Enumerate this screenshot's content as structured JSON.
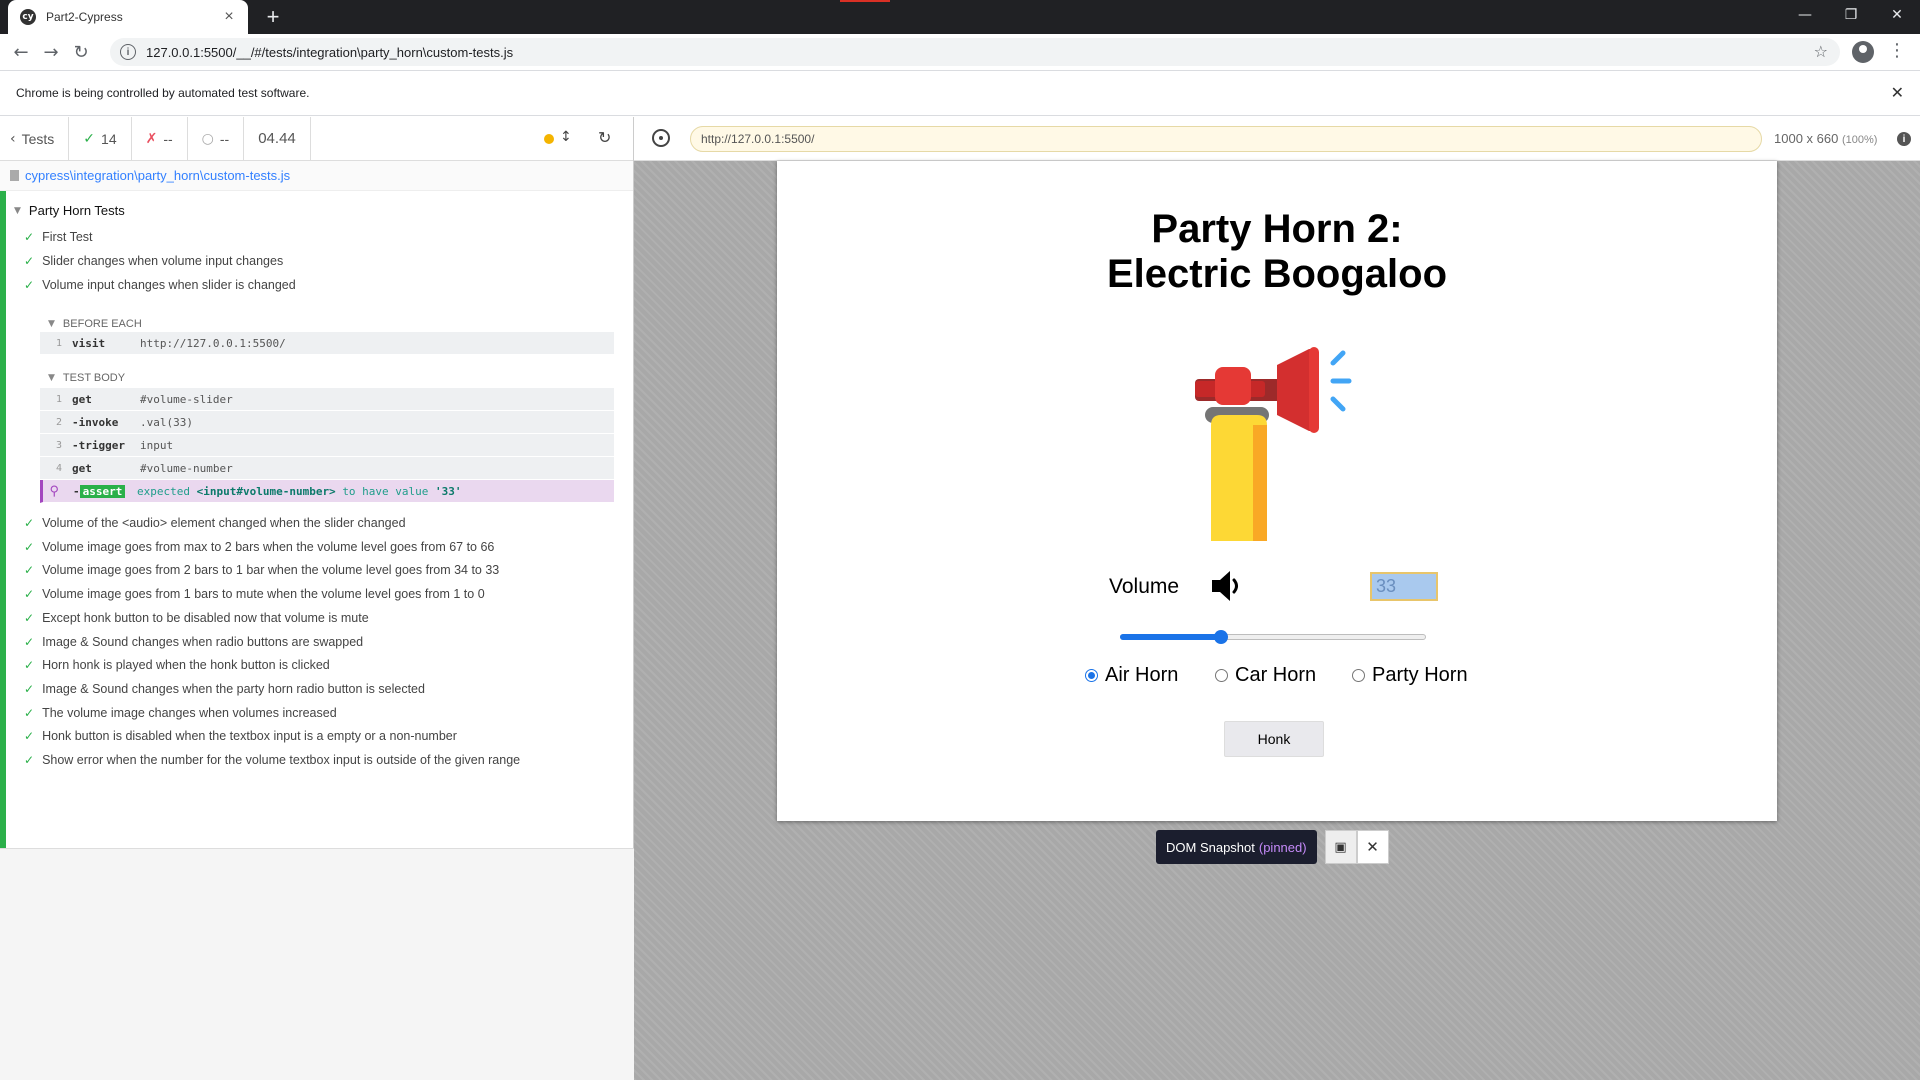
{
  "browser": {
    "tab_title": "Part2-Cypress",
    "tab_favicon": "cy",
    "url": "127.0.0.1:5500/__/#/tests/integration\\party_horn\\custom-tests.js",
    "infobar_text": "Chrome is being controlled by automated test software."
  },
  "reporter": {
    "back_label": "Tests",
    "passed": "14",
    "failed": "--",
    "pending": "--",
    "duration": "04.44",
    "spec_path": "cypress\\integration\\party_horn\\custom-tests.js",
    "suite_title": "Party Horn Tests",
    "tests_before": [
      "First Test",
      "Slider changes when volume input changes",
      "Volume input changes when slider is changed"
    ],
    "before_each_label": "BEFORE EACH",
    "before_each_cmds": [
      {
        "num": "1",
        "name": "visit",
        "msg": "http://127.0.0.1:5500/"
      }
    ],
    "test_body_label": "TEST BODY",
    "test_body_cmds": [
      {
        "num": "1",
        "name": "get",
        "msg": "#volume-slider"
      },
      {
        "num": "2",
        "name": "-invoke",
        "msg": ".val(33)"
      },
      {
        "num": "3",
        "name": "-trigger",
        "msg": "input"
      },
      {
        "num": "4",
        "name": "get",
        "msg": "#volume-number"
      }
    ],
    "assert_cmd": {
      "name": "assert",
      "msg_prefix": "expected",
      "msg_subject": "<input#volume-number>",
      "msg_mid": "to have value",
      "msg_value": "'33'"
    },
    "tests_after": [
      "Volume of the <audio> element changed when the slider changed",
      "Volume image goes from max to 2 bars when the volume level goes from 67 to 66",
      "Volume image goes from 2 bars to 1 bar when the volume level goes from 34 to 33",
      "Volume image goes from 1 bars to mute when the volume level goes from 1 to 0",
      "Except honk button to be disabled now that volume is mute",
      "Image & Sound changes when radio buttons are swapped",
      "Horn honk is played when the honk button is clicked",
      "Image & Sound changes when the party horn radio button is selected",
      "The volume image changes when volumes increased",
      "Honk button is disabled when the textbox input is a empty or a non-number",
      "Show error when the number for the volume textbox input is outside of the given range"
    ]
  },
  "aut": {
    "url": "http://127.0.0.1:5500/",
    "viewport": "1000 x 660",
    "viewport_pct": "(100%)"
  },
  "app": {
    "title_line1": "Party Horn 2:",
    "title_line2": "Electric Boogaloo",
    "volume_label": "Volume",
    "volume_value": "33",
    "slider_value": 33,
    "radios": [
      {
        "label": "Air Horn",
        "checked": true
      },
      {
        "label": "Car Horn",
        "checked": false
      },
      {
        "label": "Party Horn",
        "checked": false
      }
    ],
    "honk_label": "Honk"
  },
  "snapshot": {
    "label": "DOM Snapshot",
    "pinned": "(pinned)"
  },
  "colors": {
    "pass": "#2bb04a",
    "fail": "#e94f5f",
    "accent": "#1a73e8"
  }
}
